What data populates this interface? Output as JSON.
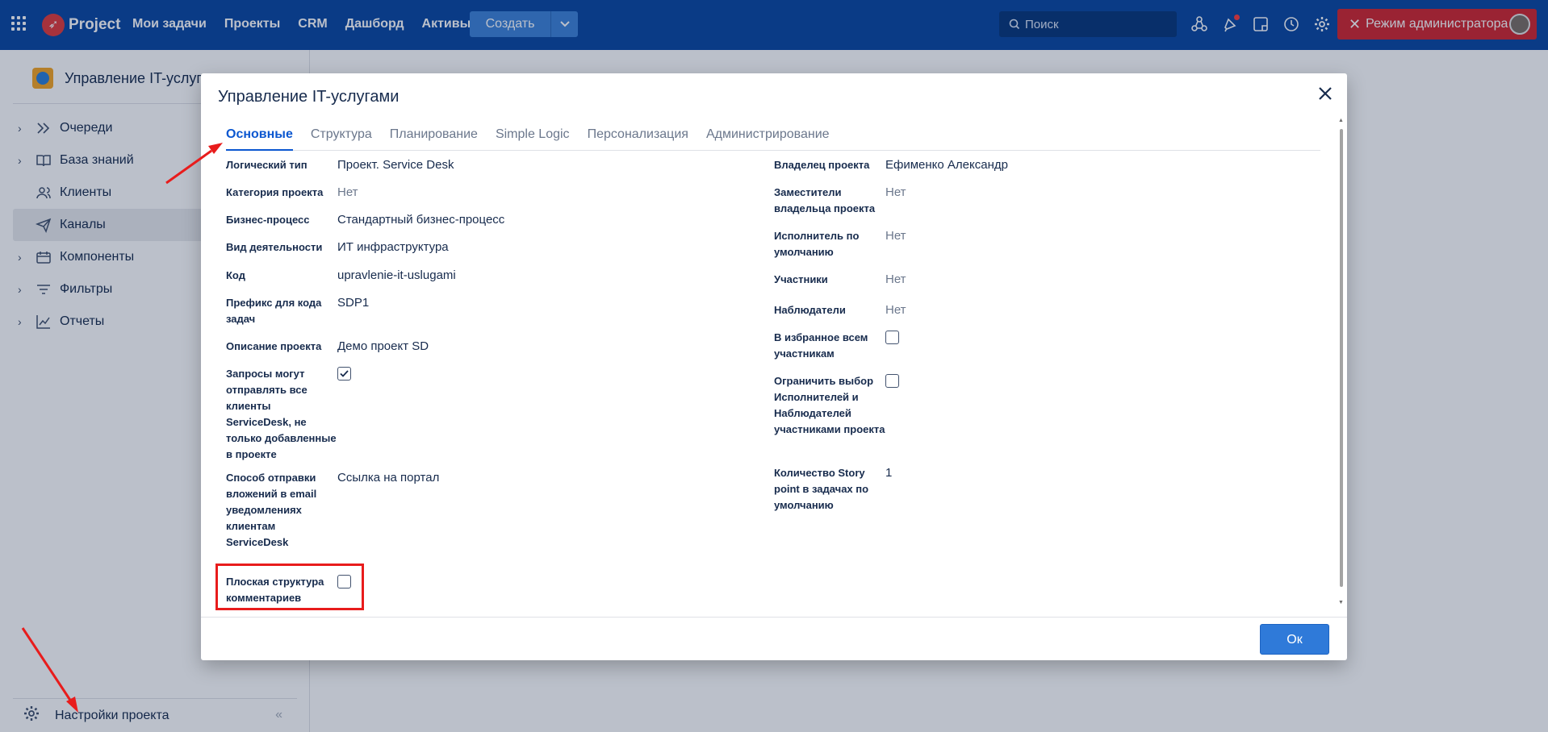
{
  "topbar": {
    "brand": "Project",
    "nav": [
      "Мои задачи",
      "Проекты",
      "CRM",
      "Дашборд",
      "Активы"
    ],
    "create_label": "Создать",
    "search_placeholder": "Поиск",
    "admin_label": "Режим администратора"
  },
  "sidebar": {
    "project_name": "Управление IT-услугам",
    "items": [
      {
        "label": "Очереди",
        "icon": "queues-icon",
        "chevron": true,
        "active": false
      },
      {
        "label": "База знаний",
        "icon": "book-icon",
        "chevron": true,
        "active": false
      },
      {
        "label": "Клиенты",
        "icon": "clients-icon",
        "chevron": false,
        "active": false
      },
      {
        "label": "Каналы",
        "icon": "send-icon",
        "chevron": false,
        "active": true
      },
      {
        "label": "Компоненты",
        "icon": "components-icon",
        "chevron": true,
        "active": false
      },
      {
        "label": "Фильтры",
        "icon": "filter-icon",
        "chevron": true,
        "active": false
      },
      {
        "label": "Отчеты",
        "icon": "chart-icon",
        "chevron": true,
        "active": false
      }
    ],
    "settings_label": "Настройки проекта",
    "collapse_glyph": "«"
  },
  "modal": {
    "title": "Управление IT-услугами",
    "tabs": [
      "Основные",
      "Структура",
      "Планирование",
      "Simple Logic",
      "Персонализация",
      "Администрирование"
    ],
    "active_tab": 0,
    "left_fields": [
      {
        "label": "Логический тип",
        "value": "Проект. Service Desk",
        "type": "text"
      },
      {
        "label": "Категория проекта",
        "value": "Нет",
        "type": "muted"
      },
      {
        "label": "Бизнес-процесс",
        "value": "Стандартный бизнес-процесс",
        "type": "text"
      },
      {
        "label": "Вид деятельности",
        "value": "ИТ инфраструктура",
        "type": "text"
      },
      {
        "label": "Код",
        "value": "upravlenie-it-uslugami",
        "type": "text"
      },
      {
        "label": "Префикс для кода задач",
        "value": "SDP1",
        "type": "text"
      },
      {
        "label": "Описание проекта",
        "value": "Демо проект SD",
        "type": "text"
      },
      {
        "label": "Запросы могут отправлять все клиенты ServiceDesk, не только добавленные в проекте",
        "checked": true,
        "type": "checkbox"
      },
      {
        "label": "Способ отправки вложений в email уведомлениях клиентам ServiceDesk",
        "value": "Ссылка на портал",
        "type": "text"
      },
      {
        "label": "Плоская структура комментариев",
        "checked": false,
        "type": "checkbox"
      }
    ],
    "right_fields": [
      {
        "label": "Владелец проекта",
        "value": "Ефименко Александр",
        "type": "text"
      },
      {
        "label": "Заместители владельца проекта",
        "value": "Нет",
        "type": "muted"
      },
      {
        "label": "Исполнитель по умолчанию",
        "value": "Нет",
        "type": "muted"
      },
      {
        "label": "Участники",
        "value": "Нет",
        "type": "muted"
      },
      {
        "label": "Наблюдатели",
        "value": "Нет",
        "type": "muted"
      },
      {
        "label": "В избранное всем участникам",
        "checked": false,
        "type": "checkbox"
      },
      {
        "label": "Ограничить выбор Исполнителей и Наблюдателей участниками проекта",
        "checked": false,
        "type": "checkbox"
      },
      {
        "label": "Количество Story point в задачах по умолчанию",
        "value": "1",
        "type": "text"
      }
    ],
    "ok_label": "Ок"
  },
  "colors": {
    "topbar": "#0b47a1",
    "admin": "#d1262e",
    "accent": "#0b57d0",
    "annotation": "#e81c1c"
  }
}
